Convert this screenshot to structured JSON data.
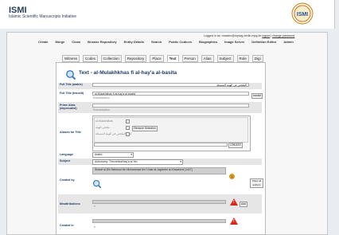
{
  "app": {
    "title": "ISMI",
    "subtitle": "Islamic Scientific Manuscripts Initiative",
    "seal_text": "ISMI"
  },
  "login": {
    "prefix": "Logged in as: ",
    "user": "mcastro@mpiwg-berlin.mpg.de",
    "logout": "logout",
    "change_password": "change password"
  },
  "nav": [
    "Create",
    "Merge",
    "Clean",
    "Browse Repository",
    "Entity Details",
    "Search",
    "Public Codices",
    "Biographies",
    "Image Server",
    "Definition Editor",
    "Admin"
  ],
  "tabs": [
    "Witness",
    "Codex",
    "Collection",
    "Repository",
    "Place",
    "Text",
    "Person",
    "Alias",
    "Subject",
    "Role",
    "Digi"
  ],
  "active_tab": "Text",
  "page_title": "Text - al-Mulakhkhas fi al-hay'a al-basita",
  "form": {
    "full_title_label": "Full Title (arabic)",
    "full_title_value": "الملخص في الهيئة البسيطة",
    "translit_label": "Full Title (translit)",
    "translit_value": "al-Mulakhkhas fi al-hay'a al-basita",
    "translit_hint": "Romanization",
    "translit_button": "translit",
    "prime_alias_label": "Prime Alias (deprecated)",
    "prime_alias_hint": "Romanization",
    "aliases_label": "Aliases for Title",
    "aliases": [
      "al-Mulakhkhas",
      "ملخص الهيئة",
      "كتاب الملخص في الهيئة البسيطة"
    ],
    "remove_selection": "Remove Selection",
    "create_button": "CREATE",
    "language_label": "Language",
    "language_value": "Arabic",
    "subject_label": "Subject",
    "subject_value": "Astronomy: Theoretical/hay'a al-'ilm",
    "created_by_label": "Created by",
    "created_by_value": "Sharaf al-Din Mahmud ibn Muhammad ibn 'Umar al-Jaghmini al-Khwarizmi [1427]",
    "show_all_authors": "Show all authors",
    "misattributions_label": "Misattributions",
    "add_button": "Add",
    "created_in_label": "Created in"
  },
  "icons": {
    "magnifier": "magnifier-icon",
    "face": "smiley-icon",
    "warning": "warning-triangle-icon"
  },
  "colors": {
    "header_text": "#2b3e5c",
    "label_text": "#1f3b66",
    "warning": "#d9261c",
    "row_bg": "#e6e6e6"
  }
}
